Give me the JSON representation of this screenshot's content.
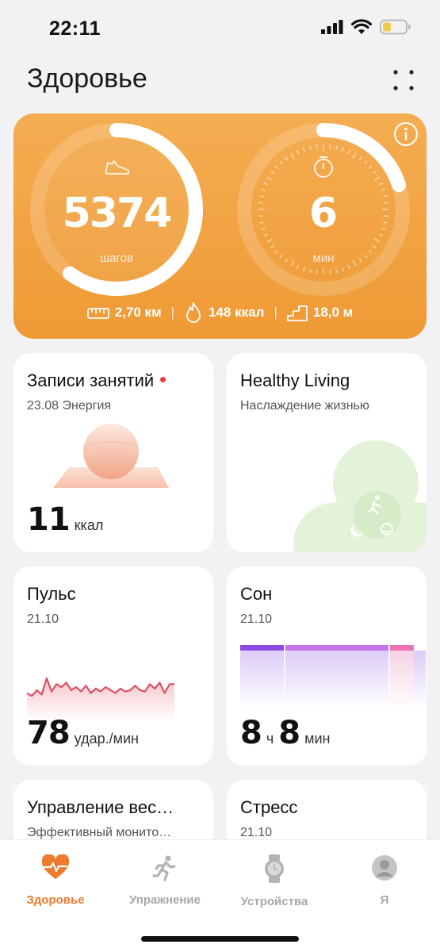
{
  "status_bar": {
    "time": "22:11"
  },
  "header": {
    "title": "Здоровье"
  },
  "hero": {
    "steps": {
      "value": "5374",
      "unit": "шагов",
      "progress": 0.6
    },
    "active_minutes": {
      "value": "6",
      "unit": "мин",
      "progress": 0.2
    },
    "stats": {
      "distance": "2,70 км",
      "calories": "148 ккал",
      "floors": "18,0 м"
    },
    "colors": {
      "bg": "#f19d3a",
      "ring": "#ffffff"
    }
  },
  "cards": {
    "workouts": {
      "title": "Записи занятий",
      "subtitle": "23.08 Энергия",
      "value": "11",
      "unit": "ккал"
    },
    "healthy_living": {
      "title": "Healthy Living",
      "subtitle": "Наслаждение жизнью"
    },
    "pulse": {
      "title": "Пульс",
      "subtitle": "21.10",
      "value": "78",
      "unit": "удар./мин",
      "trend": [
        72,
        70,
        74,
        71,
        82,
        73,
        78,
        76,
        79,
        74,
        76,
        73,
        77,
        72,
        75,
        73,
        76,
        74,
        72,
        75,
        73,
        74,
        77,
        74,
        73,
        78,
        75,
        79,
        72,
        78,
        78
      ]
    },
    "sleep": {
      "title": "Сон",
      "subtitle": "21.10",
      "hours": "8",
      "hours_unit": "ч",
      "minutes": "8",
      "minutes_unit": "мин"
    },
    "weight": {
      "title": "Управление вес…",
      "subtitle": "Эффективный монито…"
    },
    "stress": {
      "title": "Стресс",
      "subtitle": "21.10"
    }
  },
  "nav": {
    "items": [
      {
        "label": "Здоровье",
        "icon": "heart-pulse-icon",
        "active": true
      },
      {
        "label": "Упражнение",
        "icon": "runner-icon",
        "active": false
      },
      {
        "label": "Устройства",
        "icon": "watch-icon",
        "active": false
      },
      {
        "label": "Я",
        "icon": "profile-icon",
        "active": false
      }
    ],
    "colors": {
      "active": "#ee7a2d",
      "inactive": "#a8a8a8"
    }
  }
}
